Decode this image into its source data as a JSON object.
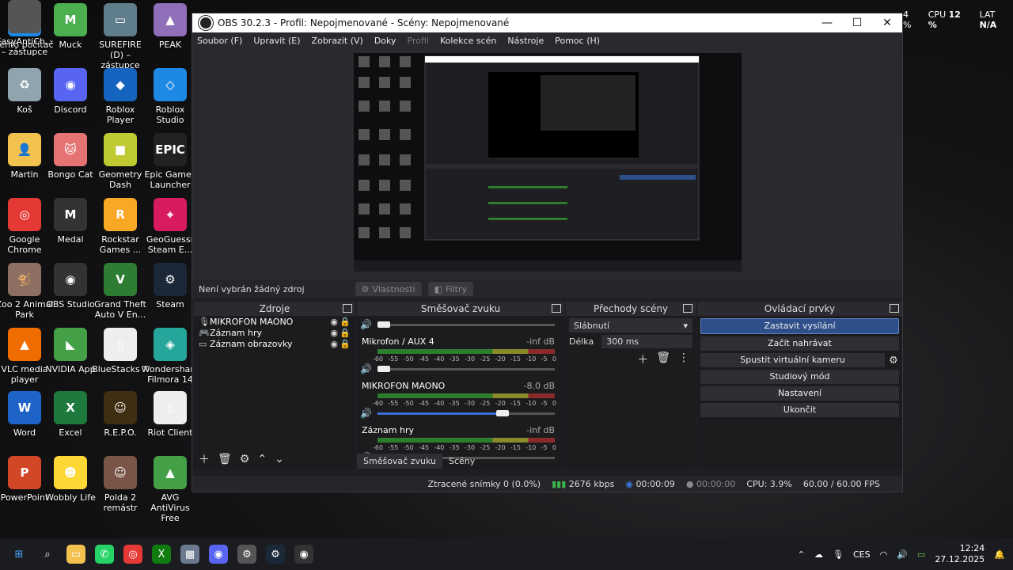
{
  "desktop": {
    "icons": [
      {
        "label": "Tento počítač",
        "color": "#1e88e5",
        "glyph": "🖥"
      },
      {
        "label": "Muck",
        "color": "#4caf50",
        "glyph": "M"
      },
      {
        "label": "SUREFIRE (D) – zástupce",
        "color": "#607d8b",
        "glyph": "▭"
      },
      {
        "label": "PEAK",
        "color": "#8e6fb8",
        "glyph": "▲"
      },
      {
        "label": "Koš",
        "color": "#90a4ae",
        "glyph": "♻"
      },
      {
        "label": "Discord",
        "color": "#5865f2",
        "glyph": "◉"
      },
      {
        "label": "Roblox Player",
        "color": "#1565c0",
        "glyph": "◆"
      },
      {
        "label": "Roblox Studio",
        "color": "#1e88e5",
        "glyph": "◇"
      },
      {
        "label": "Martin",
        "color": "#f2c14e",
        "glyph": "👤"
      },
      {
        "label": "Bongo Cat",
        "color": "#e57373",
        "glyph": "🐱"
      },
      {
        "label": "Geometry Dash",
        "color": "#c0ca33",
        "glyph": "■"
      },
      {
        "label": "Epic Games Launcher",
        "color": "#222",
        "glyph": "EPIC"
      },
      {
        "label": "Google Chrome",
        "color": "#e53935",
        "glyph": "◎"
      },
      {
        "label": "Medal",
        "color": "#333",
        "glyph": "M"
      },
      {
        "label": "Rockstar Games ...",
        "color": "#f9a825",
        "glyph": "R"
      },
      {
        "label": "GeoGuessr Steam E...",
        "color": "#d81b60",
        "glyph": "⌖"
      },
      {
        "label": "Zoo 2 Animal Park",
        "color": "#8d6e63",
        "glyph": "🐒"
      },
      {
        "label": "OBS Studio",
        "color": "#333",
        "glyph": "◉"
      },
      {
        "label": "Grand Theft Auto V En...",
        "color": "#2e7d32",
        "glyph": "V"
      },
      {
        "label": "Steam",
        "color": "#1b2838",
        "glyph": "⚙"
      },
      {
        "label": "VLC media player",
        "color": "#ef6c00",
        "glyph": "▲"
      },
      {
        "label": "NVIDIA App",
        "color": "#43a047",
        "glyph": "◣"
      },
      {
        "label": "BlueStacks X",
        "color": "#eee",
        "glyph": "▯"
      },
      {
        "label": "Wondershare Filmora 14",
        "color": "#26a69a",
        "glyph": "◈"
      },
      {
        "label": "Word",
        "color": "#1e63c7",
        "glyph": "W"
      },
      {
        "label": "Excel",
        "color": "#1d7a3c",
        "glyph": "X"
      },
      {
        "label": "R.E.P.O.",
        "color": "#3e2f12",
        "glyph": "☺"
      },
      {
        "label": "Riot Client",
        "color": "#eee",
        "glyph": "▯"
      },
      {
        "label": "PowerPoint",
        "color": "#d24726",
        "glyph": "P"
      },
      {
        "label": "Wobbly Life",
        "color": "#fdd835",
        "glyph": "☻"
      },
      {
        "label": "Polda 2 remástr",
        "color": "#795548",
        "glyph": "☺"
      },
      {
        "label": "AVG AntiVirus Free",
        "color": "#43a047",
        "glyph": "▲"
      },
      {
        "label": "EasyAntiCh... – zástupce",
        "color": "#555",
        "glyph": ""
      }
    ]
  },
  "topstats": {
    "cpu_label": "CPU",
    "cpu_value": "12 %",
    "lat_label": "LAT",
    "lat_value": "N/A",
    "partial": "4 %"
  },
  "window": {
    "title": "OBS 30.2.3 - Profil: Nepojmenované - Scény: Nepojmenované",
    "min": "—",
    "max": "☐",
    "close": "✕"
  },
  "menu": [
    "Soubor (F)",
    "Upravit (E)",
    "Zobrazit (V)",
    "Doky",
    "Profil",
    "Kolekce scén",
    "Nástroje",
    "Pomoc (H)"
  ],
  "source_toolbar": {
    "no_source": "Není vybrán žádný zdroj",
    "properties": "Vlastnosti",
    "filters": "Filtry"
  },
  "sources": {
    "title": "Zdroje",
    "items": [
      {
        "label": "MIKROFON MAONO",
        "icon": "🎙"
      },
      {
        "label": "Záznam hry",
        "icon": "🎮"
      },
      {
        "label": "Záznam obrazovky",
        "icon": "▭"
      }
    ]
  },
  "mixer": {
    "title": "Směšovač zvuku",
    "ticks": [
      "-60",
      "-55",
      "-50",
      "-45",
      "-40",
      "-35",
      "-30",
      "-25",
      "-20",
      "-15",
      "-10",
      "-5",
      "0"
    ],
    "channels": [
      {
        "name": "Mikrofon / AUX 4",
        "db": "-inf dB",
        "fader": 0.0
      },
      {
        "name": "MIKROFON MAONO",
        "db": "-8.0 dB",
        "fader": 0.72
      },
      {
        "name": "Záznam hry",
        "db": "-inf dB",
        "fader": 0.0
      }
    ]
  },
  "transitions": {
    "title": "Přechody scény",
    "selected": "Slábnutí",
    "duration_label": "Délka",
    "duration_value": "300 ms"
  },
  "controls": {
    "title": "Ovládací prvky",
    "buttons": [
      "Zastavit vysílání",
      "Začít nahrávat",
      "Spustit virtuální kameru",
      "Studiový mód",
      "Nastavení",
      "Ukončit"
    ]
  },
  "dock_tabs": [
    "Směšovač zvuku",
    "Scény"
  ],
  "status": {
    "dropped": "Ztracené snímky 0 (0.0%)",
    "bitrate": "2676 kbps",
    "stream_time": "00:00:09",
    "rec_time": "00:00:00",
    "cpu": "CPU: 3.9%",
    "fps": "60.00 / 60.00 FPS"
  },
  "tray": {
    "lang": "CES",
    "time": "12:24",
    "date": "27.12.2025"
  }
}
